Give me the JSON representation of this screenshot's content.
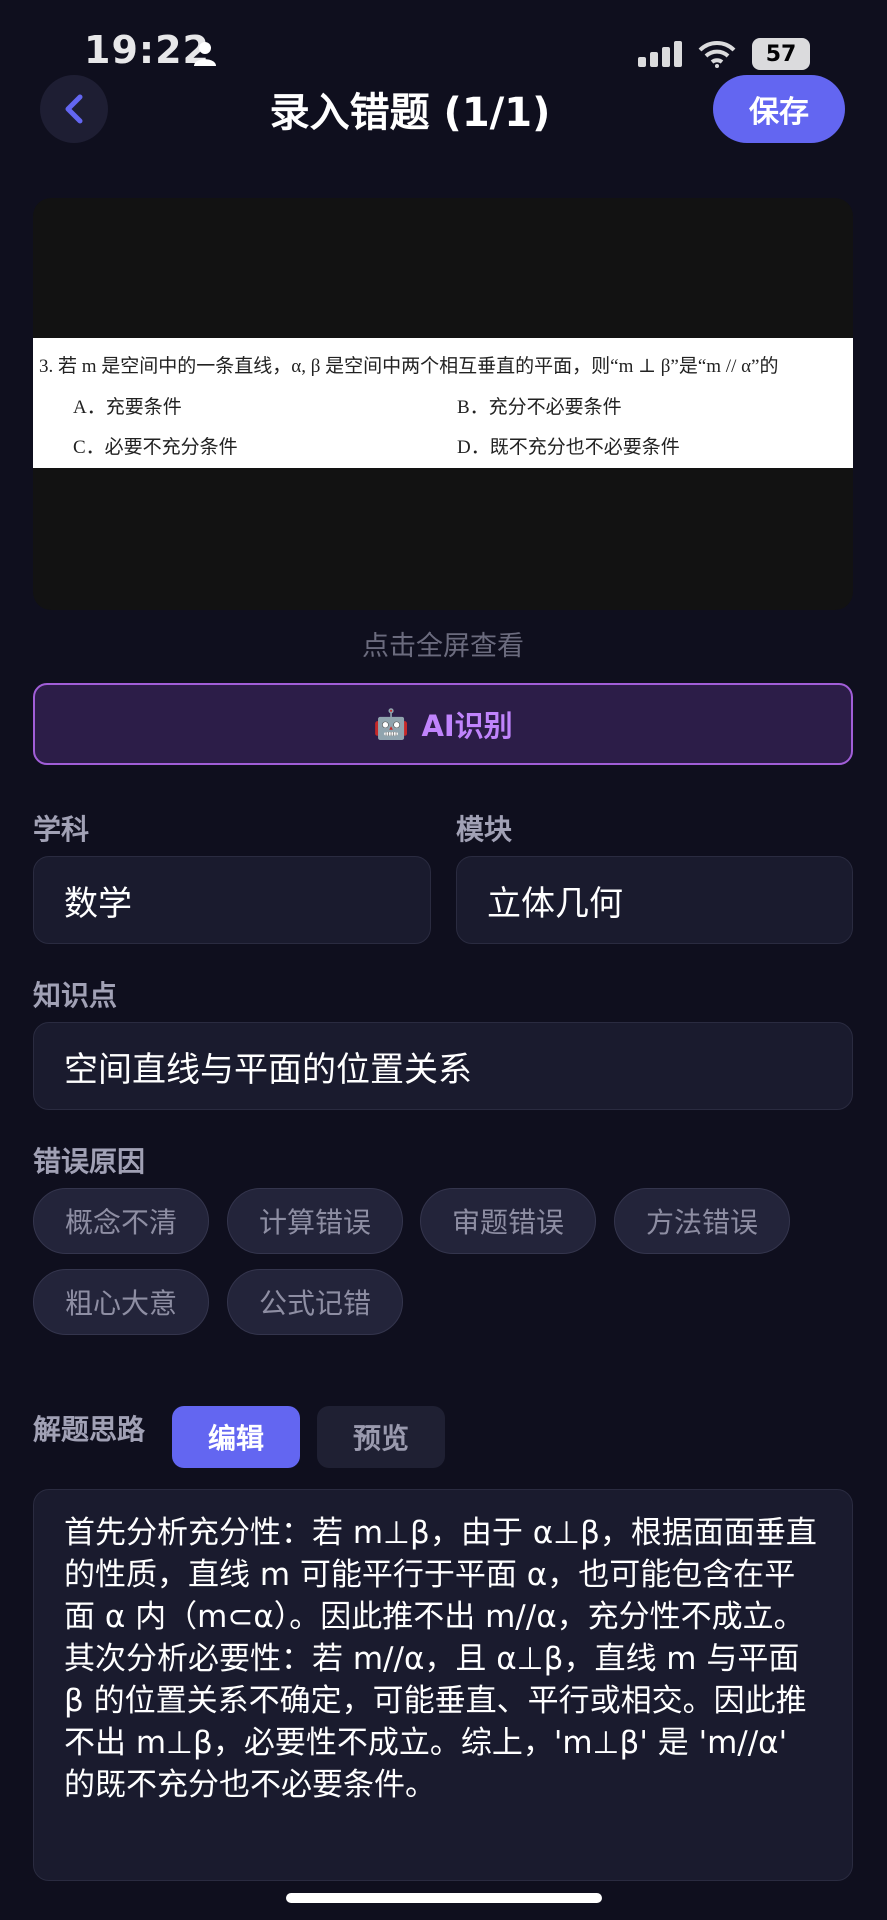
{
  "status_bar": {
    "time": "19:22",
    "battery": "57"
  },
  "header": {
    "back_icon": "chevron-left-icon",
    "title": "录入错题 (1/1)",
    "save_label": "保存"
  },
  "question_image": {
    "main": "3.   若 m 是空间中的一条直线，α, β 是空间中两个相互垂直的平面，则“m ⊥ β”是“m // α”的",
    "options": {
      "a": "A．充要条件",
      "b": "B．充分不必要条件",
      "c": "C．必要不充分条件",
      "d": "D．既不充分也不必要条件"
    }
  },
  "fullscreen_hint": "点击全屏查看",
  "ai_button": {
    "icon": "🤖",
    "label": "AI识别"
  },
  "form": {
    "subject_label": "学科",
    "subject_value": "数学",
    "module_label": "模块",
    "module_value": "立体几何",
    "knowledge_label": "知识点",
    "knowledge_value": "空间直线与平面的位置关系",
    "reason_label": "错误原因",
    "reasons": [
      "概念不清",
      "计算错误",
      "审题错误",
      "方法错误",
      "粗心大意",
      "公式记错"
    ],
    "approach_label": "解题思路",
    "tab_edit": "编辑",
    "tab_preview": "预览",
    "approach_text": "首先分析充分性：若 m⊥β，由于 α⊥β，根据面面垂直的性质，直线 m 可能平行于平面 α，也可能包含在平面 α 内（m⊂α）。因此推不出 m//α，充分性不成立。其次分析必要性：若 m//α，且 α⊥β，直线 m 与平面 β 的位置关系不确定，可能垂直、平行或相交。因此推不出 m⊥β，必要性不成立。综上，'m⊥β' 是 'm//α' 的既不充分也不必要条件。"
  },
  "colors": {
    "background": "#0f0f1e",
    "accent": "#6366f1",
    "ai_purple": "#c084fc"
  }
}
